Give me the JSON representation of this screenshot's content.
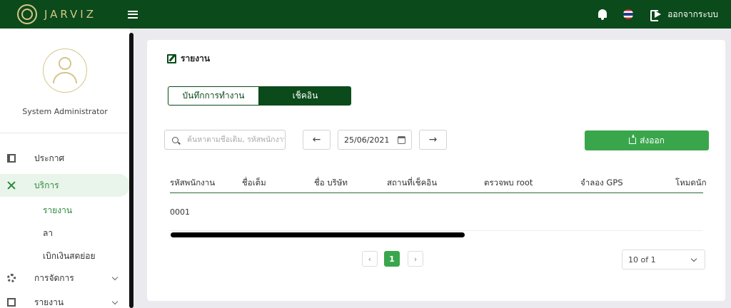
{
  "app": {
    "logo_text": "JARVIZ",
    "logout_label": "ออกจากระบบ"
  },
  "user": {
    "name": "System Administrator"
  },
  "sidebar": {
    "items": [
      {
        "label": "ประกาศ",
        "icon": "news-icon"
      },
      {
        "label": "บริการ",
        "icon": "tools-icon",
        "active": true
      },
      {
        "label": "การจัดการ",
        "icon": "gear-icon"
      },
      {
        "label": "รายงาน",
        "icon": "report-icon"
      }
    ],
    "subitems": [
      {
        "label": "รายงาน",
        "active": true
      },
      {
        "label": "ลา"
      },
      {
        "label": "เบิกเงินสดย่อย"
      }
    ]
  },
  "page": {
    "title": "รายงาน"
  },
  "tabs": {
    "work_log": "บันทึกการทำงาน",
    "check_in": "เช็คอิน"
  },
  "search": {
    "placeholder": "ค้นหาตามชื่อเต็ม, รหัสพนักงาน"
  },
  "date": {
    "value": "25/06/2021"
  },
  "export": {
    "label": "ส่งออก"
  },
  "table": {
    "columns": [
      "รหัสพนักงาน",
      "ชื่อเต็ม",
      "ชื่อ บริษัท",
      "สถานที่เช็คอิน",
      "ตรวจพบ root",
      "จำลอง GPS",
      "โหมดนัก"
    ],
    "rows": [
      {
        "employee_id": "0001"
      }
    ]
  },
  "pagination": {
    "current_page": "1",
    "page_size": "10 of 1"
  },
  "colors": {
    "brand_dark": "#0b4a1a",
    "accent": "#3aa64c",
    "gold": "#d6c58a"
  }
}
